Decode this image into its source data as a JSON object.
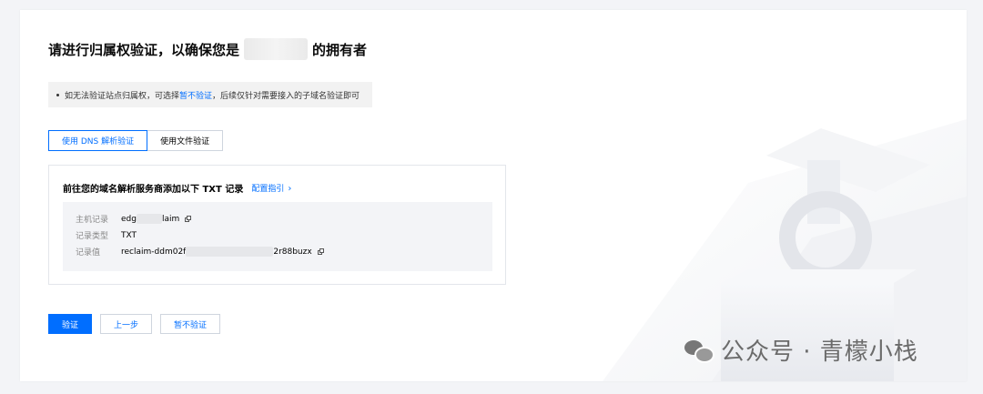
{
  "page": {
    "title_prefix": "请进行归属权验证，以确保您是",
    "title_suffix": "的拥有者"
  },
  "tip": {
    "prefix": "如无法验证站点归属权，可选择",
    "link": "暂不验证",
    "suffix": "，后续仅针对需要接入的子域名验证即可"
  },
  "tabs": [
    {
      "label": "使用 DNS 解析验证",
      "active": true
    },
    {
      "label": "使用文件验证",
      "active": false
    }
  ],
  "panel": {
    "heading": "前往您的域名解析服务商添加以下 TXT 记录",
    "guide_link": "配置指引",
    "guide_chevron": "›",
    "records": [
      {
        "label": "主机记录",
        "value_start": "edg",
        "value_end": "laim",
        "copyable": true
      },
      {
        "label": "记录类型",
        "value_start": "TXT",
        "value_end": "",
        "copyable": false
      },
      {
        "label": "记录值",
        "value_start": "reclaim-ddm02f",
        "value_end": "2r88buzx",
        "copyable": true
      }
    ]
  },
  "buttons": {
    "verify": "验证",
    "previous": "上一步",
    "skip": "暂不验证"
  },
  "watermark": {
    "text": "公众号 · 青檬小栈",
    "icon": "wechat-icon"
  },
  "colors": {
    "accent": "#006eff",
    "background": "#f3f4f7"
  }
}
